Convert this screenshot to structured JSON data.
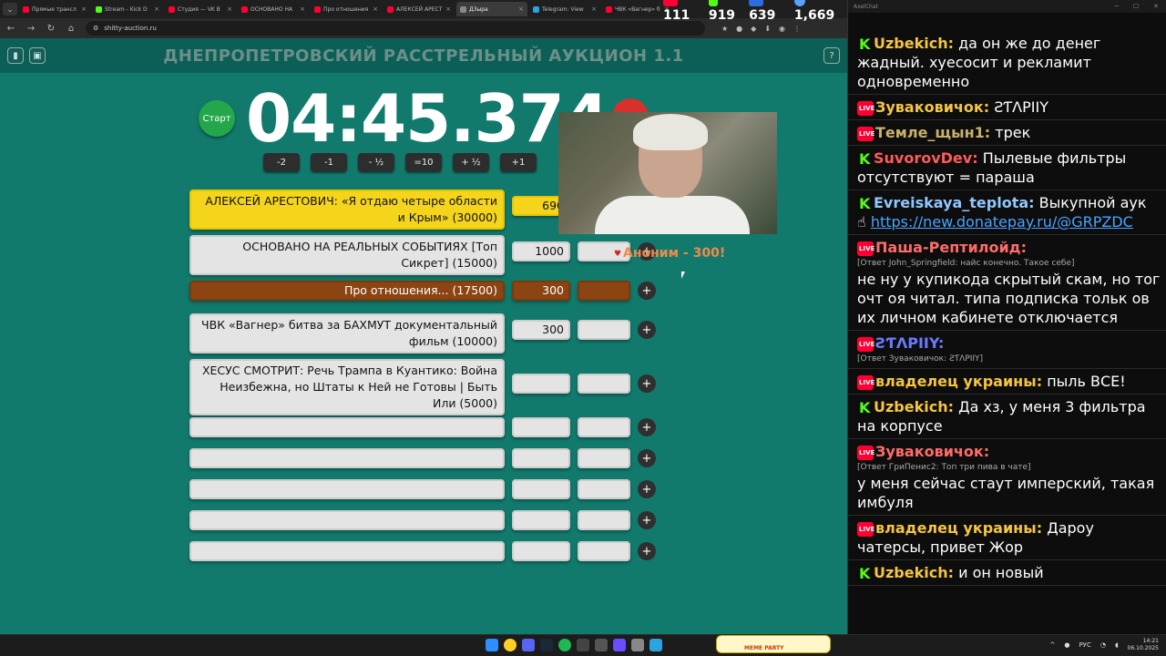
{
  "browser": {
    "tabs": [
      {
        "title": "Прямые трансл",
        "color": "#ff0033",
        "active": false
      },
      {
        "title": "Stream - Kick D",
        "color": "#53fc18",
        "active": false
      },
      {
        "title": "Студия — VK В",
        "color": "#ff0033",
        "active": false
      },
      {
        "title": "ОСНОВАНО НА",
        "color": "#ff0033",
        "active": false
      },
      {
        "title": "Про отношения",
        "color": "#ff0033",
        "active": false
      },
      {
        "title": "АЛЕКСЕЙ АРЕСТ",
        "color": "#ff0033",
        "active": false
      },
      {
        "title": "Д3ыра",
        "color": "#888888",
        "active": true
      },
      {
        "title": "Telegram: View",
        "color": "#2aa3e0",
        "active": false
      },
      {
        "title": "ЧВК «Вагнер» б",
        "color": "#ff0033",
        "active": false
      }
    ],
    "url": "shitty-auction.ru"
  },
  "stats_overlay": {
    "youtube": "111",
    "kick": "919",
    "vk": "639",
    "viewers": "1,669"
  },
  "auction": {
    "title": "ДНЕПРОПЕТРОВСКИЙ РАССТРЕЛЬНЫЙ АУКЦИОН 1.1",
    "start_label": "Старт",
    "timer": "04:45.374",
    "adjust_buttons": [
      "-2",
      "-1",
      "- ½",
      "=10",
      "+ ½",
      "+1"
    ],
    "lots": [
      {
        "name": "АЛЕКСЕЙ АРЕСТОВИЧ: «Я отдаю четыре области и Крым» (30000)",
        "amount": "690",
        "style": "gold"
      },
      {
        "name": "ОСНОВАНО НА РЕАЛЬНЫХ СОБЫТИЯХ [Топ Сикрет] (15000)",
        "amount": "1000",
        "style": "normal"
      },
      {
        "name": "Про отношения... (17500)",
        "amount": "300",
        "style": "brown"
      },
      {
        "name": "ЧВК «Вагнер» битва за БАХМУТ документальный фильм (10000)",
        "amount": "300",
        "style": "normal"
      },
      {
        "name": "ХЕСУС СМОТРИТ: Речь Трампа в Куантико: Война Неизбежна, но Штаты к Ней не Готовы | Быть Или (5000)",
        "amount": "",
        "style": "normal"
      },
      {
        "name": "",
        "amount": "",
        "style": "normal"
      },
      {
        "name": "",
        "amount": "",
        "style": "normal"
      },
      {
        "name": "",
        "amount": "",
        "style": "normal"
      },
      {
        "name": "",
        "amount": "",
        "style": "normal"
      },
      {
        "name": "",
        "amount": "",
        "style": "normal"
      }
    ],
    "plus_label": "+",
    "donation_popup": "Аноним - 300!"
  },
  "chat": {
    "window_title": "AxelChat",
    "messages": [
      {
        "platform": "kick",
        "user": "Uzbekich:",
        "color": "#f4c542",
        "text": "да он же до денег жадный. хуесосит и рекламит одновременно"
      },
      {
        "platform": "vk",
        "user": "Зуваковичок:",
        "color": "#f4c542",
        "text": "ƧƬΛPIIY"
      },
      {
        "platform": "vk",
        "user": "Темле_щын1:",
        "color": "#c8b26a",
        "text": "трек"
      },
      {
        "platform": "kick",
        "user": "SuvorovDev:",
        "color": "#ff5a5a",
        "text": "Пылевые фильтры отсутствуют = параша"
      },
      {
        "platform": "kick",
        "user": "Evreiskaya_teplota:",
        "color": "#8fc7ff",
        "text": "Выкупной аук",
        "link": "https://new.donatepay.ru/@GRPZDC"
      },
      {
        "platform": "vk",
        "user": "Паша-Рептилойд:",
        "color": "#ff6b6b",
        "reply": "[Ответ John_Springfield: найс конечно. Такое себе]",
        "text": "не ну у купикода скрытый скам, но тог очт оя читал. типа подписка тольк ов их личном кабинете отключается"
      },
      {
        "platform": "vk",
        "user": "ƧƬΛPIIY:",
        "color": "#6a7cff",
        "reply": "[Ответ Зуваковичок: ƧƬΛPIIY]",
        "text": ""
      },
      {
        "platform": "vk",
        "user": "владелец украины:",
        "color": "#f4c542",
        "text": "пыль ВСЕ!"
      },
      {
        "platform": "kick",
        "user": "Uzbekich:",
        "color": "#f4c542",
        "text": "Да хз, у меня 3 фильтра на корпусе"
      },
      {
        "platform": "vk",
        "user": "Зуваковичок:",
        "color": "#ff6b6b",
        "reply": "[Ответ ГриПенис2: Топ три пива в чате]",
        "text": "у меня сейчас стаут имперский, такая имбуля"
      },
      {
        "platform": "vk",
        "user": "владелец украины:",
        "color": "#f4c542",
        "text": "Дароу чатерсы, привет Жор"
      },
      {
        "platform": "kick",
        "user": "Uzbekich:",
        "color": "#f4c542",
        "text": "и он новый"
      }
    ]
  },
  "taskbar": {
    "lang": "РУС",
    "time": "14:21",
    "date": "06.10.2025",
    "widget": "MEME PARTY"
  }
}
